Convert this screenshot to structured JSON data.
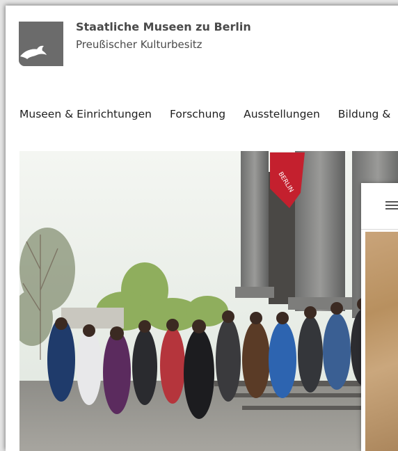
{
  "header": {
    "title": "Staatliche Museen zu Berlin",
    "subtitle": "Preußischer Kulturbesitz",
    "logo_icon": "eagle-logo-icon"
  },
  "nav": {
    "items": [
      {
        "label": "Museen & Einrichtungen"
      },
      {
        "label": "Forschung"
      },
      {
        "label": "Ausstellungen"
      },
      {
        "label": "Bildung &"
      }
    ]
  },
  "hero": {
    "image": "school-group-at-museum-entrance",
    "banner_text": "BERLIN"
  },
  "overlay": {
    "menu_icon": "hamburger-menu-icon"
  },
  "colors": {
    "text_dark": "#1e1e1e",
    "logo_gray": "#6b6b6b",
    "banner_red": "#c4202e"
  }
}
